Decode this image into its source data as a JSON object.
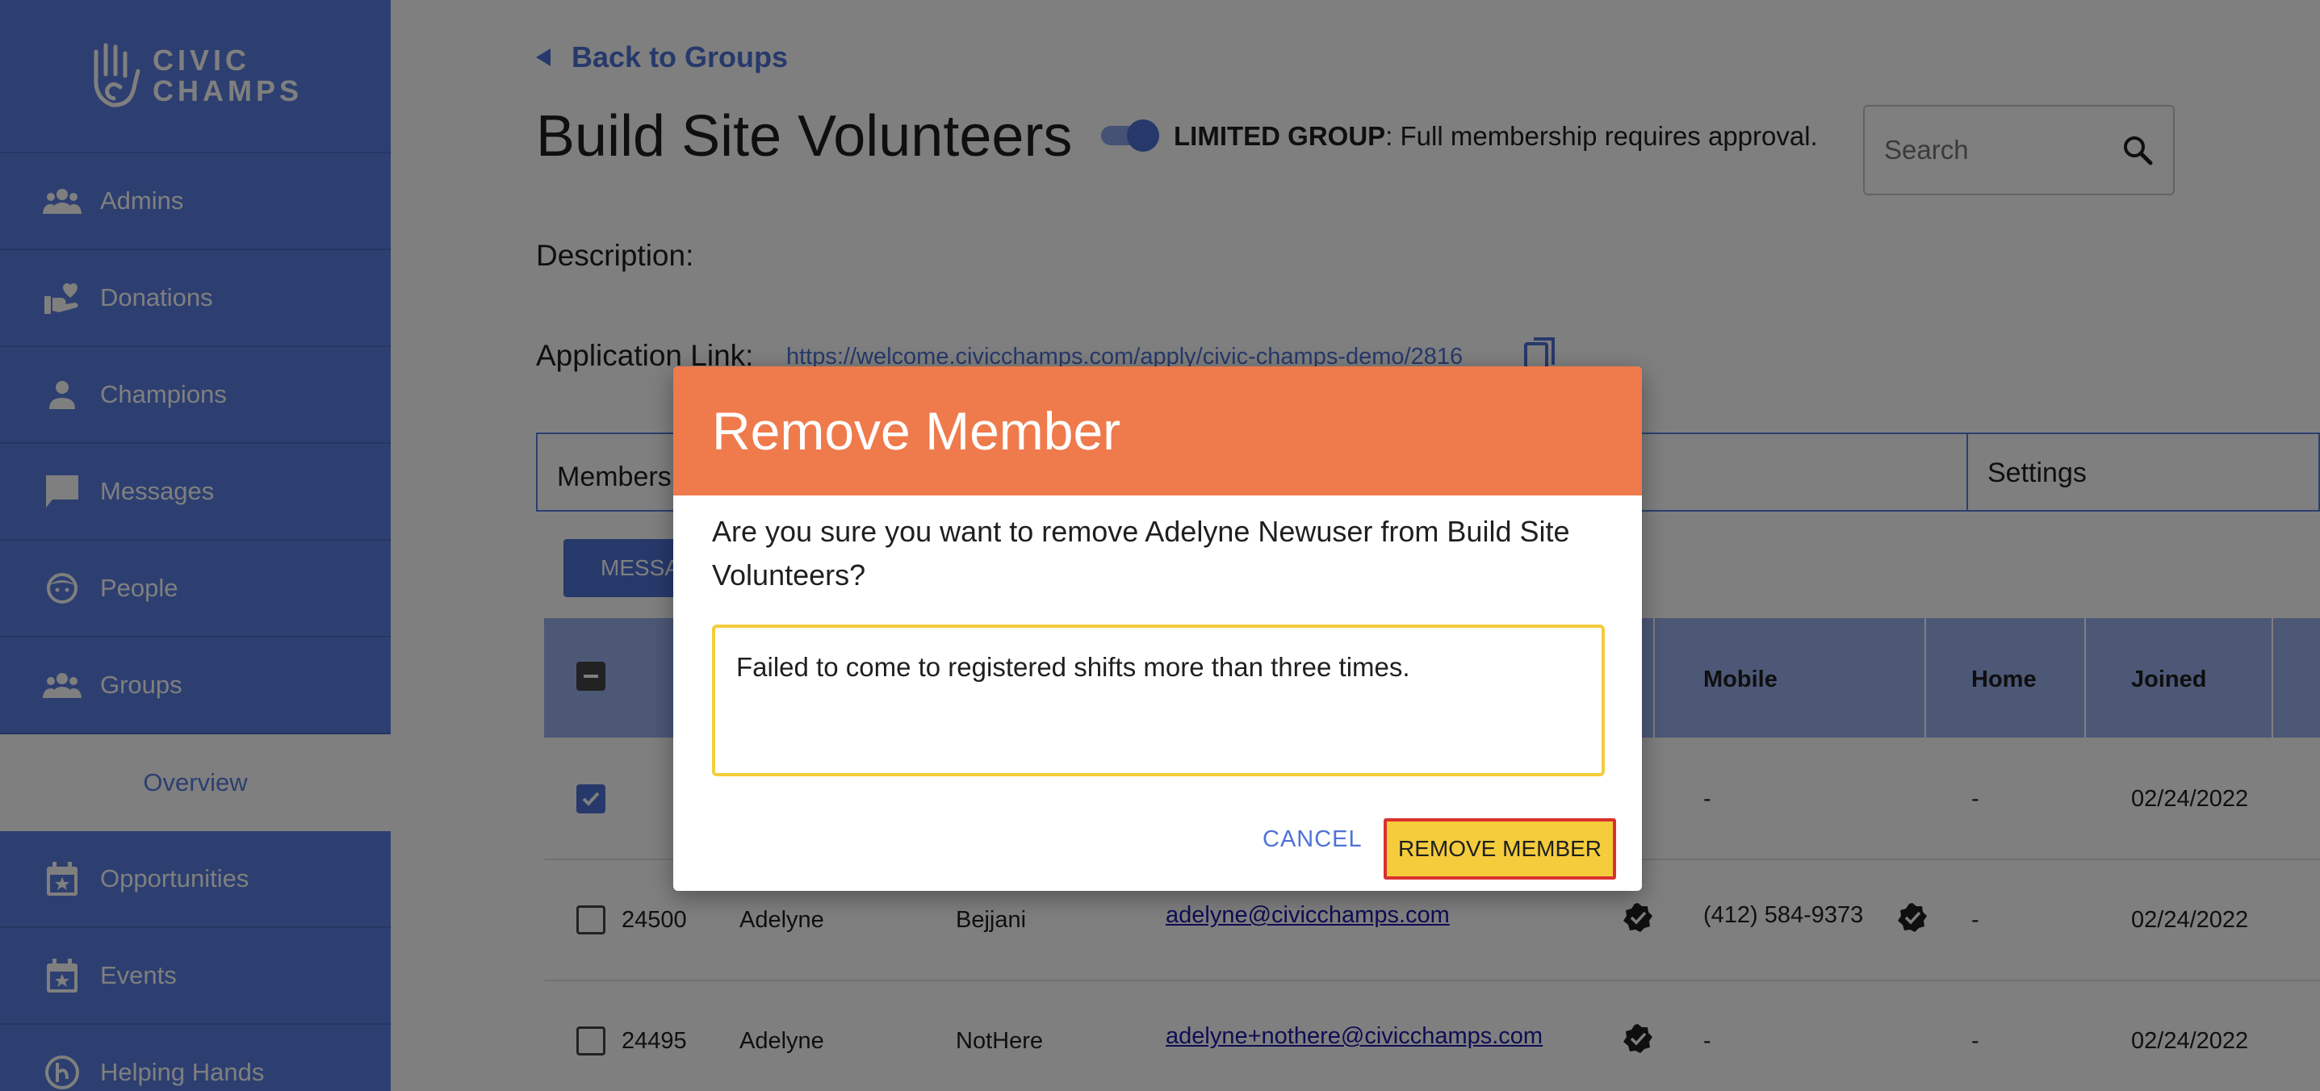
{
  "brand": {
    "line1": "CIVIC",
    "line2": "CHAMPS"
  },
  "sidebar": {
    "items": [
      {
        "label": "Admins",
        "icon": "admins-icon"
      },
      {
        "label": "Donations",
        "icon": "donations-icon"
      },
      {
        "label": "Champions",
        "icon": "person-icon"
      },
      {
        "label": "Messages",
        "icon": "chat-icon"
      },
      {
        "label": "People",
        "icon": "face-icon"
      },
      {
        "label": "Groups",
        "icon": "groups-icon"
      },
      {
        "label": "Overview",
        "icon": ""
      },
      {
        "label": "Opportunities",
        "icon": "calendar-star-icon"
      },
      {
        "label": "Events",
        "icon": "calendar-star-icon"
      },
      {
        "label": "Helping Hands",
        "icon": "helping-hands-icon"
      }
    ]
  },
  "header": {
    "back_label": "Back to Groups",
    "title": "Build Site Volunteers",
    "limited_bold": "LIMITED GROUP",
    "limited_text": ": Full membership requires approval.",
    "search_placeholder": "Search"
  },
  "details": {
    "description_label": "Description:",
    "app_link_label": "Application Link:",
    "app_link_url": "https://welcome.civicchamps.com/apply/civic-champs-demo/2816"
  },
  "tabs": {
    "members": "Members",
    "settings": "Settings"
  },
  "toolbar": {
    "message_label": "MESSAGE"
  },
  "table": {
    "headers": {
      "mobile": "Mobile",
      "home": "Home",
      "joined": "Joined"
    },
    "rows": [
      {
        "checked": true,
        "id": "",
        "first": "",
        "last": "",
        "email": "",
        "mobile": "-",
        "home": "-",
        "joined": "02/24/2022"
      },
      {
        "checked": false,
        "id": "24500",
        "first": "Adelyne",
        "last": "Bejjani",
        "email": "adelyne@civicchamps.com",
        "mobile": "(412) 584-9373",
        "home": "-",
        "joined": "02/24/2022"
      },
      {
        "checked": false,
        "id": "24495",
        "first": "Adelyne",
        "last": "NotHere",
        "email": "adelyne+nothere@civicchamps.com",
        "mobile": "-",
        "home": "-",
        "joined": "02/24/2022"
      }
    ]
  },
  "modal": {
    "title": "Remove Member",
    "message": "Are you sure you want to remove Adelyne Newuser from Build Site Volunteers?",
    "reason": "Failed to come to registered shifts more than three times.",
    "cancel_label": "CANCEL",
    "confirm_label": "REMOVE MEMBER"
  },
  "colors": {
    "sidebar": "#5b7fe0",
    "accent": "#4f72d6",
    "modal_header": "#ef7a4c",
    "highlight": "#f4cc3c",
    "focus_border": "#d9312f"
  }
}
